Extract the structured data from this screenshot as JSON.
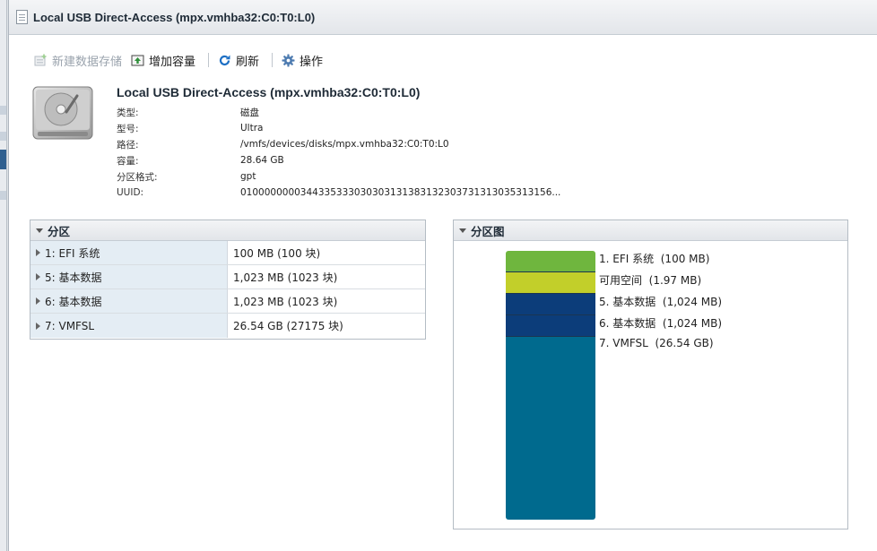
{
  "window": {
    "title": "Local USB Direct-Access (mpx.vmhba32:C0:T0:L0)"
  },
  "toolbar": {
    "new_datastore": "新建数据存储",
    "increase_capacity": "增加容量",
    "refresh": "刷新",
    "actions": "操作"
  },
  "device": {
    "name": "Local USB Direct-Access (mpx.vmhba32:C0:T0:L0)",
    "props": [
      {
        "label": "类型:",
        "value": "磁盘"
      },
      {
        "label": "型号:",
        "value": "Ultra"
      },
      {
        "label": "路径:",
        "value": "/vmfs/devices/disks/mpx.vmhba32:C0:T0:L0"
      },
      {
        "label": "容量:",
        "value": "28.64 GB"
      },
      {
        "label": "分区格式:",
        "value": "gpt"
      },
      {
        "label": "UUID:",
        "value": "0100000000344335333030303131383132303731313035313155б..."
      }
    ]
  },
  "partitions": {
    "title": "分区",
    "rows": [
      {
        "name": "1: EFI 系统",
        "size": "100 MB (100 块)"
      },
      {
        "name": "5: 基本数据",
        "size": "1,023 MB (1023 块)"
      },
      {
        "name": "6: 基本数据",
        "size": "1,023 MB (1023 块)"
      },
      {
        "name": "7: VMFSL",
        "size": "26.54 GB (27175 块)"
      }
    ]
  },
  "partition_map": {
    "title": "分区图",
    "segments": [
      {
        "label": "1. EFI 系统",
        "size": "(100 MB)",
        "color": "#6fb63e"
      },
      {
        "label": "可用空间",
        "size": "(1.97 MB)",
        "color": "#c2cf2a"
      },
      {
        "label": "5. 基本数据",
        "size": "(1,024 MB)",
        "color": "#0c3d7a"
      },
      {
        "label": "6. 基本数据",
        "size": "(1,024 MB)",
        "color": "#0c3d7a"
      },
      {
        "label": "7. VMFSL",
        "size": "(26.54 GB)",
        "color": "#006a8e"
      }
    ]
  },
  "icons": {
    "new_datastore": "new-datastore-icon",
    "increase_capacity": "increase-capacity-icon",
    "refresh": "refresh-icon",
    "actions": "gear-icon"
  }
}
